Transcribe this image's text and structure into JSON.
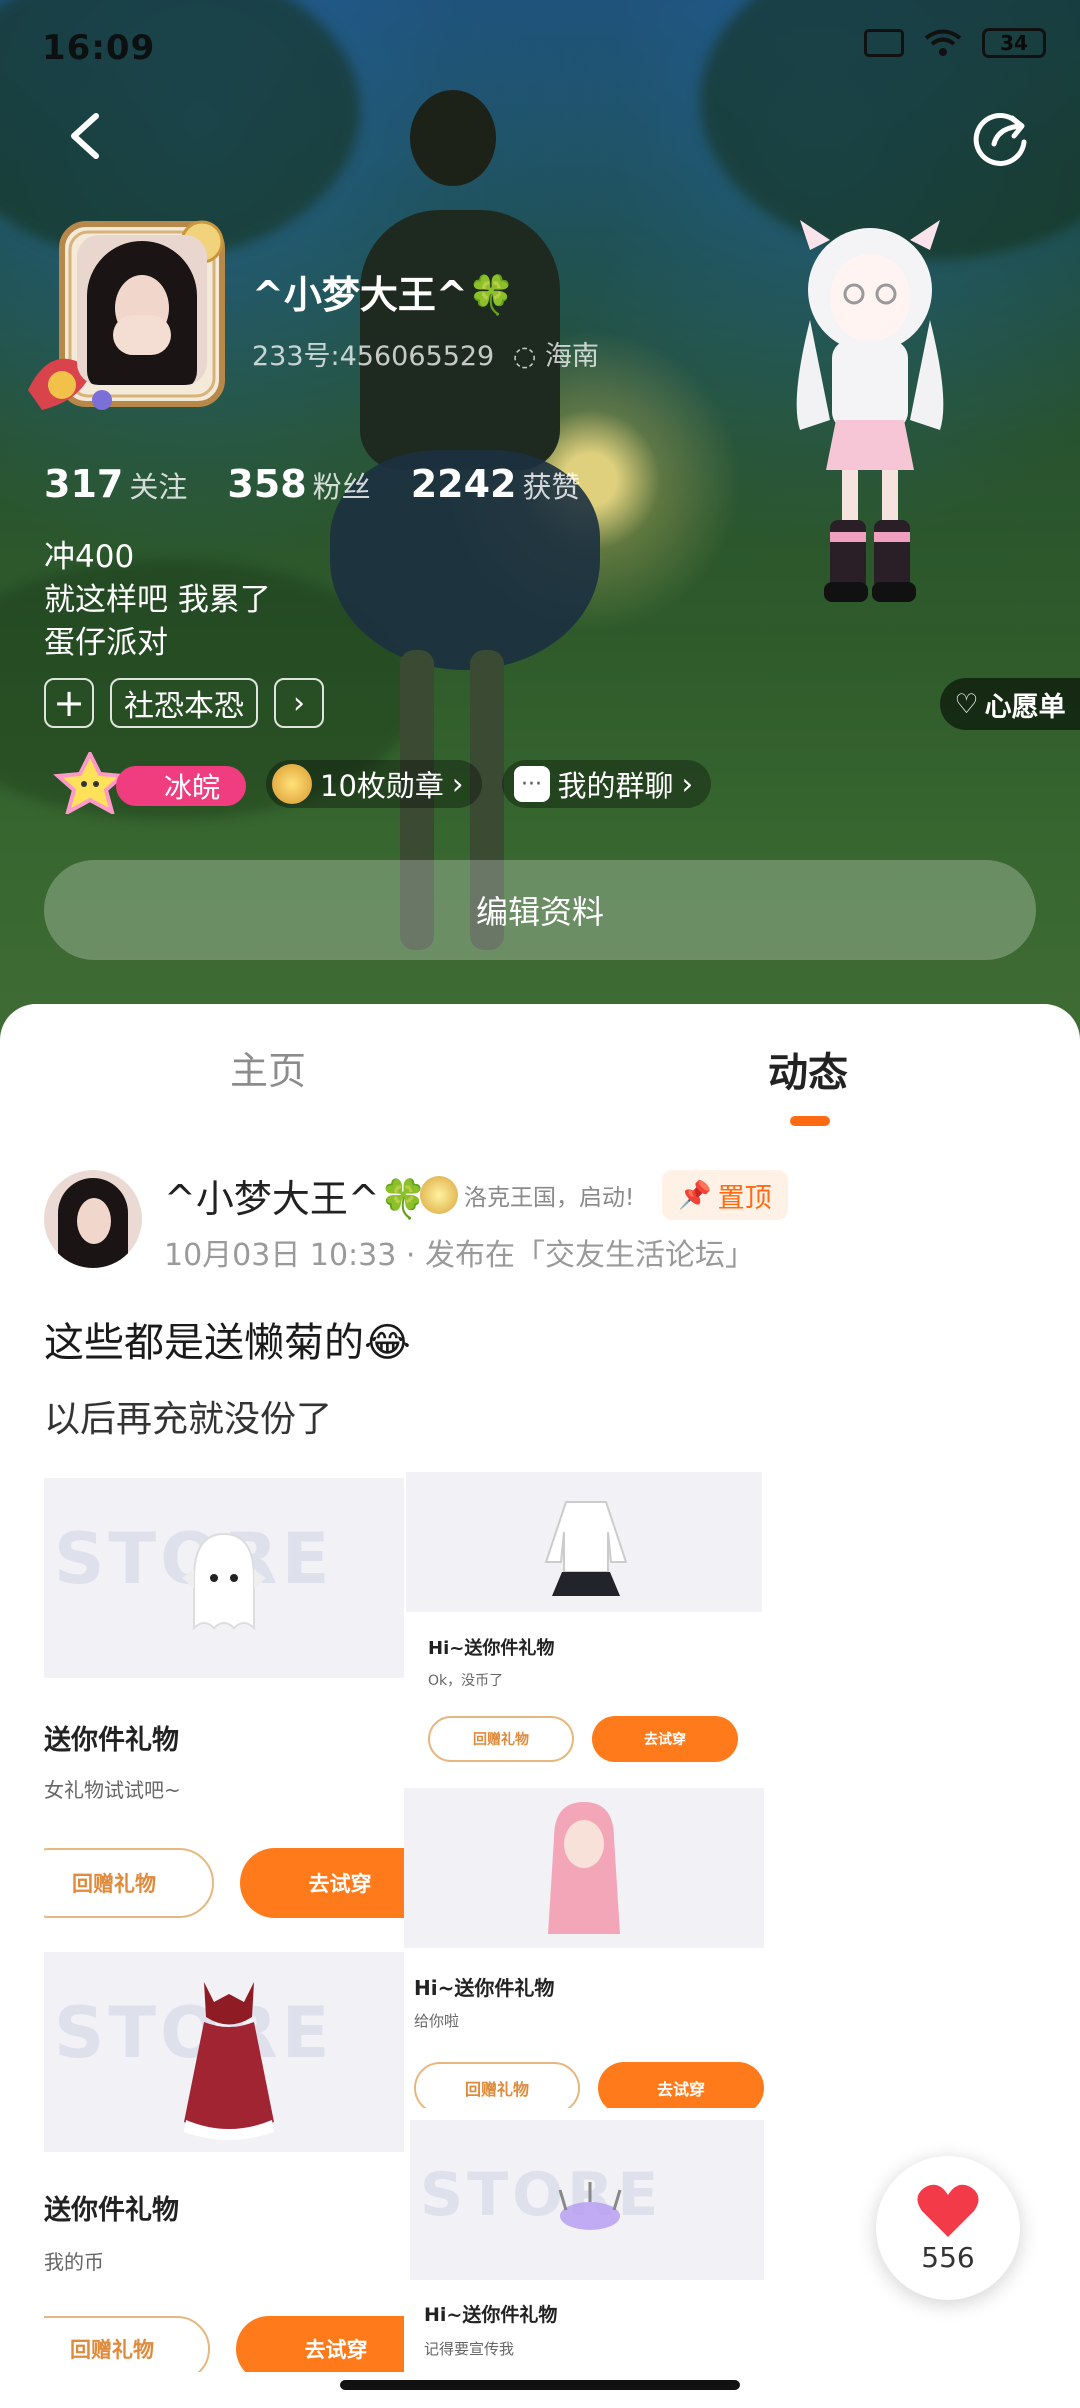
{
  "status_bar": {
    "time": "16:09",
    "battery": "34"
  },
  "profile": {
    "nickname": "^小梦大王^",
    "nickname_emoji": "🍀",
    "id_line": "233号:456065529",
    "location": "海南",
    "stats": [
      {
        "num": "317",
        "label": "关注"
      },
      {
        "num": "358",
        "label": "粉丝"
      },
      {
        "num": "2242",
        "label": "获赞"
      }
    ],
    "bio": [
      "冲400",
      "就这样吧  我累了",
      "蛋仔派对"
    ],
    "tag": "社恐本恐",
    "wishlist": "心愿单",
    "badge_name": "冰皖",
    "medals": "10枚勋章",
    "group_chat": "我的群聊",
    "edit_button": "编辑资料"
  },
  "tabs": {
    "home": "主页",
    "feed": "动态"
  },
  "post": {
    "author": "^小梦大王^",
    "author_emoji": "🍀",
    "signature": "洛克王国，启动!",
    "pin_label": "置顶",
    "meta": "10月03日 10:33 · 发布在「交友生活论坛」",
    "title": "这些都是送懒菊的😂",
    "body": "以后再充就没份了",
    "gallery": [
      {
        "title": "送你件礼物",
        "sub": "女礼物试试吧~",
        "btn_return": "回赠礼物",
        "btn_try": "去试穿"
      },
      {
        "title": "Hi~送你件礼物",
        "sub": "Ok，没币了",
        "btn_return": "回赠礼物",
        "btn_try": "去试穿"
      },
      {
        "title": "Hi~送你件礼物",
        "sub": "给你啦",
        "btn_return": "回赠礼物",
        "btn_try": "去试穿"
      },
      {
        "title": "送你件礼物",
        "sub": "我的币",
        "btn_return": "回赠礼物",
        "btn_try": "去试穿"
      },
      {
        "title": "Hi~送你件礼物",
        "sub": "记得要宣传我"
      }
    ],
    "watermark": "STORE",
    "likes": "556"
  }
}
